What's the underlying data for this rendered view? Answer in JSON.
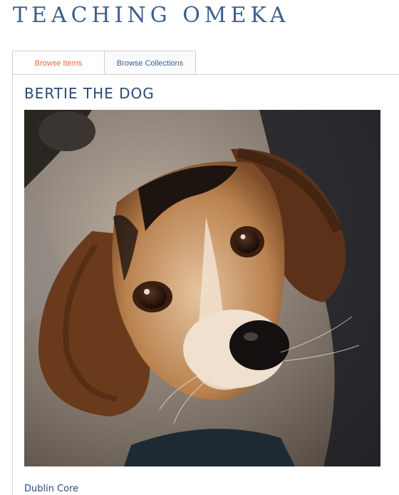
{
  "site": {
    "title": "TEACHING OMEKA"
  },
  "nav": {
    "tabs": [
      {
        "label": "Browse Items",
        "active": true
      },
      {
        "label": "Browse Collections",
        "active": false
      }
    ]
  },
  "item": {
    "title": "BERTIE THE DOG",
    "image_subject": "beagle dog photograph"
  },
  "metadata": {
    "section_heading": "Dublin Core"
  },
  "colors": {
    "title_blue": "#3d5f8c",
    "active_tab": "#e0693a",
    "heading_blue": "#2b4a72"
  }
}
